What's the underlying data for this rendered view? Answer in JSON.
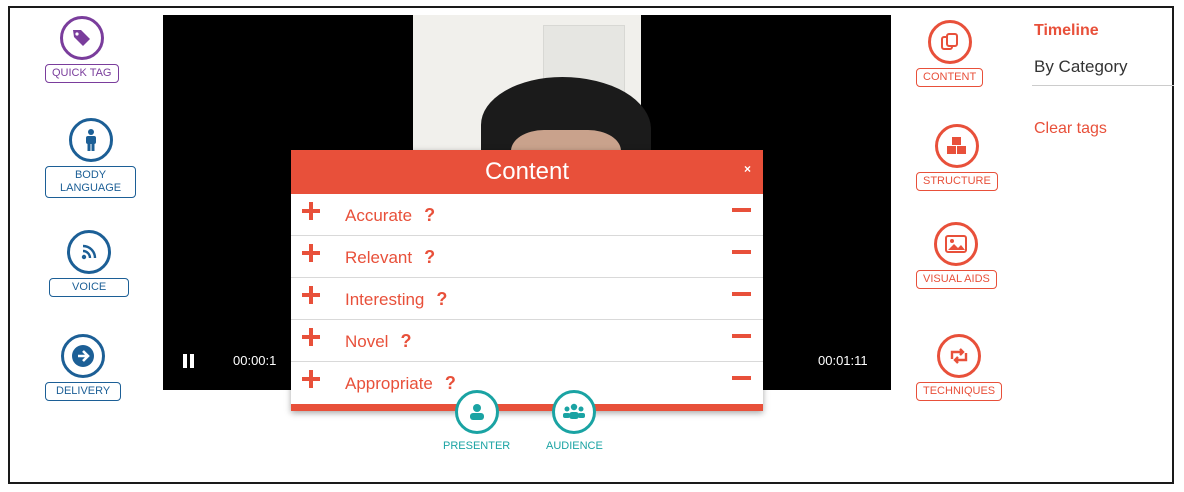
{
  "left_tools": [
    {
      "label": "QUICK TAG",
      "icon": "tag-icon"
    },
    {
      "label": "BODY\nLANGUAGE",
      "icon": "person-icon"
    },
    {
      "label": "VOICE",
      "icon": "voice-wave-icon"
    },
    {
      "label": "DELIVERY",
      "icon": "arrow-right-icon"
    }
  ],
  "right_tools": [
    {
      "label": "CONTENT",
      "icon": "content-copy-icon"
    },
    {
      "label": "STRUCTURE",
      "icon": "cubes-icon"
    },
    {
      "label": "VISUAL AIDS",
      "icon": "image-icon"
    },
    {
      "label": "TECHNIQUES",
      "icon": "retweet-icon"
    }
  ],
  "video": {
    "current_time": "00:00:1",
    "total_time": "00:01:11",
    "state_icon": "pause-icon"
  },
  "modal": {
    "title": "Content",
    "close": "×",
    "items": [
      {
        "label": "Accurate",
        "help": "?"
      },
      {
        "label": "Relevant",
        "help": "?"
      },
      {
        "label": "Interesting",
        "help": "?"
      },
      {
        "label": "Novel",
        "help": "?"
      },
      {
        "label": "Appropriate",
        "help": "?"
      }
    ]
  },
  "bottom_tools": [
    {
      "label": "PRESENTER",
      "icon": "presenter-icon"
    },
    {
      "label": "AUDIENCE",
      "icon": "audience-icon"
    }
  ],
  "sidebar": {
    "timeline": "Timeline",
    "by_category": "By Category",
    "clear_tags": "Clear tags"
  },
  "colors": {
    "accent": "#e8503a",
    "blue": "#1c5f96",
    "purple": "#7a3d9c",
    "teal": "#1aa3a3"
  }
}
